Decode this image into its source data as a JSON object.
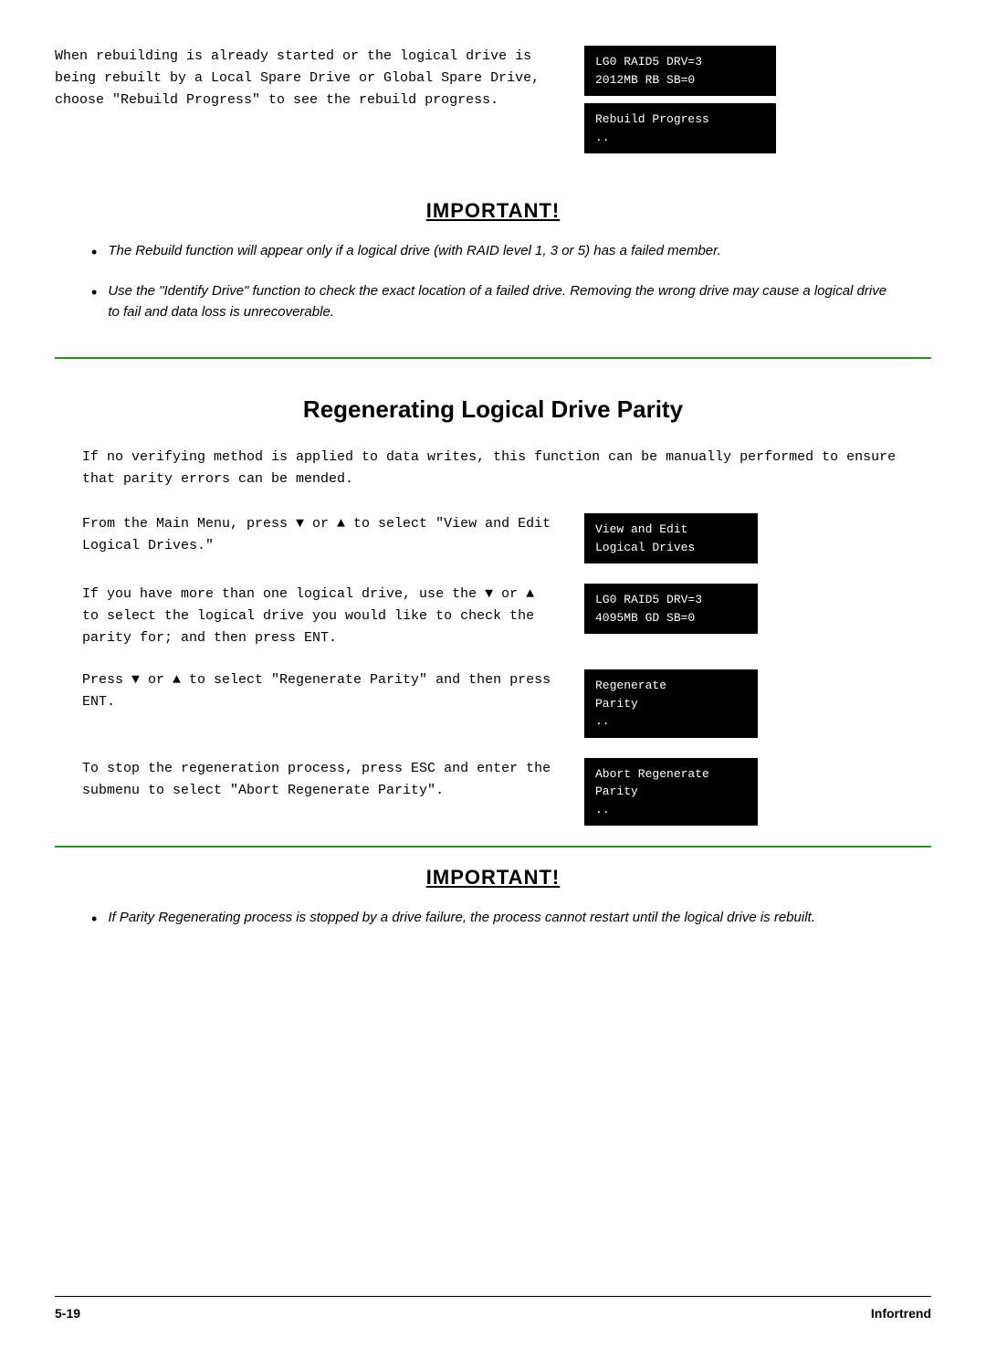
{
  "top": {
    "text": "When rebuilding is already started or the logical drive is being rebuilt by a Local Spare Drive or Global Spare Drive, choose \"Rebuild Progress\" to see the rebuild progress.",
    "panel1": {
      "line1": "LG0 RAID5 DRV=3",
      "line2": "2012MB RB SB=0"
    },
    "panel2": {
      "line1": "Rebuild Progress",
      "line2": ".."
    }
  },
  "important1": {
    "title": "IMPORTANT!",
    "bullets": [
      "The Rebuild function will appear only if a logical drive (with RAID level 1, 3 or 5) has a failed member.",
      "Use the \"Identify Drive\" function to check the exact location of a failed drive. Removing the wrong drive may cause a logical drive to fail and data loss is unrecoverable."
    ]
  },
  "regen": {
    "heading": "Regenerating Logical Drive Parity",
    "intro": "If no verifying method is applied to data writes, this function can be manually performed to ensure that parity errors can be mended.",
    "instructions": [
      {
        "text": "From the Main Menu, press ▼ or ▲ to select \"View and Edit Logical Drives.\"",
        "panel": {
          "line1": "View and Edit",
          "line2": "Logical Drives"
        }
      },
      {
        "text": "If you have more than one logical drive, use the ▼ or ▲ to select the logical drive you would like to check the parity for; and then press ENT.",
        "panel": {
          "line1": "LG0 RAID5 DRV=3",
          "line2": "4095MB GD SB=0"
        }
      },
      {
        "text": "Press ▼ or ▲ to select \"Regenerate Parity\" and then press ENT.",
        "panel": {
          "line1": "Regenerate",
          "line2": "Parity",
          "line3": ".."
        }
      },
      {
        "text": "To stop the regeneration process, press ESC and enter the submenu to select \"Abort Regenerate Parity\".",
        "panel": {
          "line1": "Abort Regenerate",
          "line2": "Parity",
          "line3": ".."
        }
      }
    ]
  },
  "important2": {
    "title": "IMPORTANT!",
    "bullets": [
      "If Parity Regenerating process is stopped by a drive failure, the process cannot restart until the logical drive is rebuilt."
    ]
  },
  "footer": {
    "page": "5-19",
    "brand": "Infortrend"
  }
}
